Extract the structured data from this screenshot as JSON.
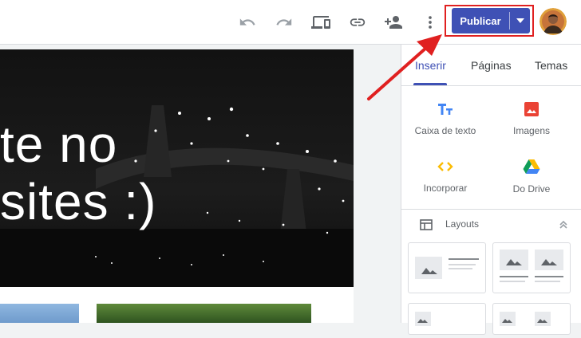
{
  "toolbar": {
    "icons": [
      "undo-icon",
      "redo-icon",
      "preview-devices-icon",
      "link-icon",
      "share-icon",
      "more-vert-icon"
    ],
    "publish_label": "Publicar"
  },
  "hero": {
    "line1": "te no",
    "line2": "sites :)"
  },
  "panel": {
    "tabs": [
      {
        "label": "Inserir"
      },
      {
        "label": "Páginas"
      },
      {
        "label": "Temas"
      }
    ],
    "items": [
      {
        "label": "Caixa de texto",
        "icon": "text-box-icon"
      },
      {
        "label": "Imagens",
        "icon": "image-icon"
      },
      {
        "label": "Incorporar",
        "icon": "embed-icon"
      },
      {
        "label": "Do Drive",
        "icon": "drive-icon"
      }
    ],
    "layouts_label": "Layouts"
  },
  "colors": {
    "accent": "#3f51b5",
    "highlight": "#e02020",
    "text_box_icon": "#4285f4",
    "image_icon": "#ea4335",
    "embed_icon": "#fbbc04"
  }
}
